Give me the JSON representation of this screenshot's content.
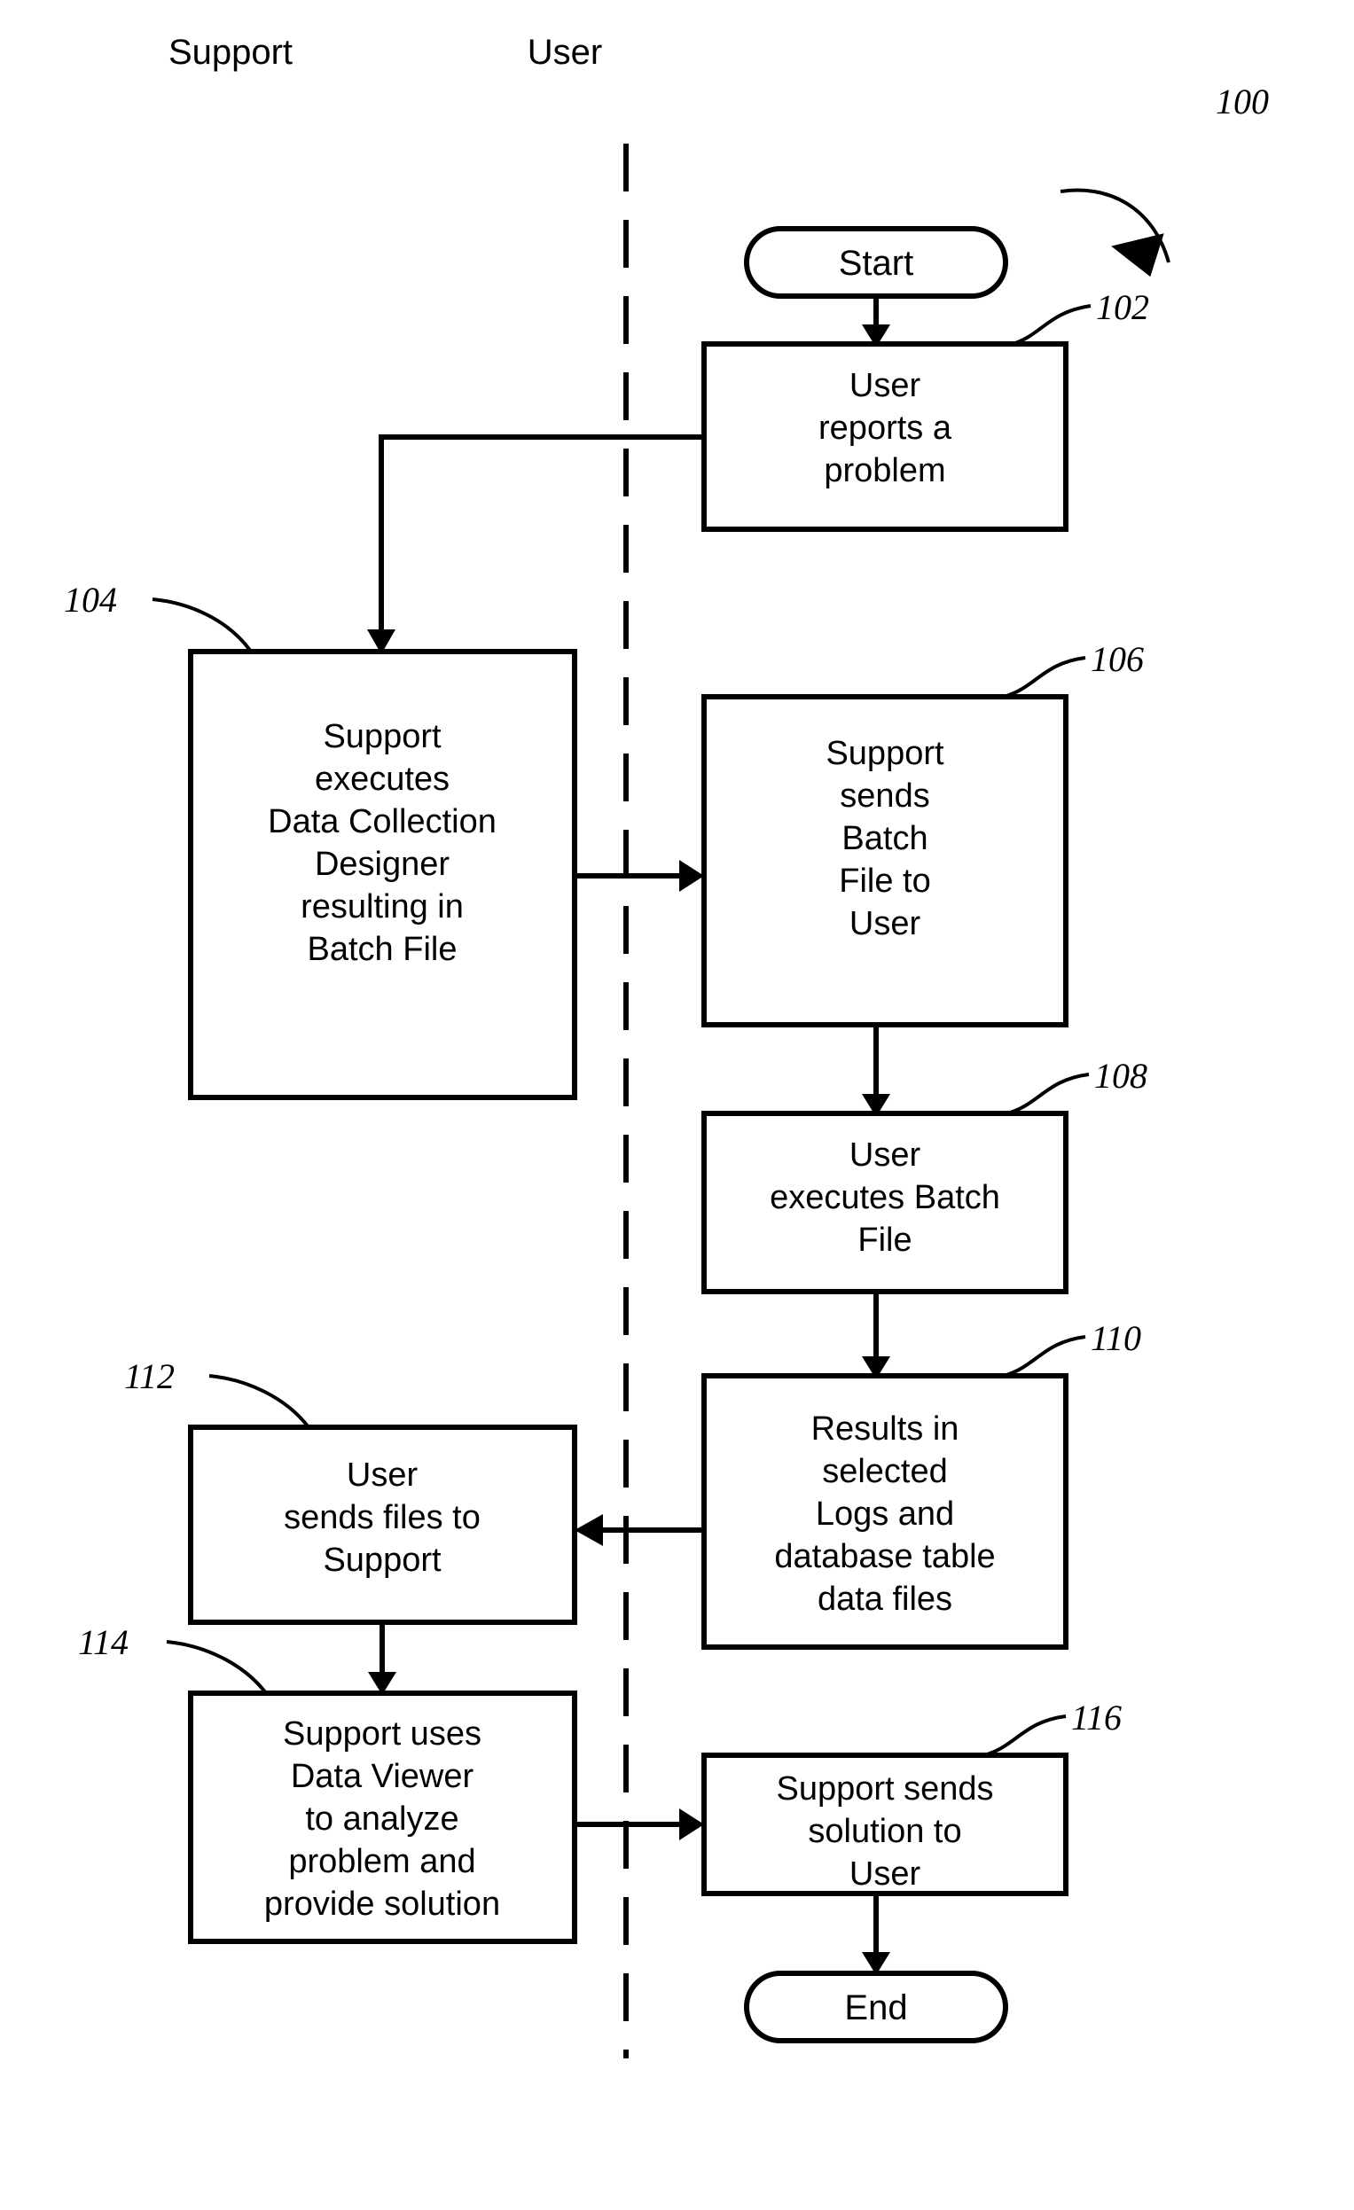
{
  "figure": {
    "reference_numeral": "100",
    "swimlanes": [
      {
        "id": "support",
        "label": "Support"
      },
      {
        "id": "user",
        "label": "User"
      }
    ],
    "terminators": {
      "start": "Start",
      "end": "End"
    },
    "nodes": [
      {
        "ref": "102",
        "lane": "user",
        "lines": [
          "User",
          "reports a",
          "problem"
        ]
      },
      {
        "ref": "104",
        "lane": "support",
        "lines": [
          "Support",
          "executes",
          "Data Collection",
          "Designer",
          "resulting in",
          "Batch File"
        ]
      },
      {
        "ref": "106",
        "lane": "user",
        "lines": [
          "Support",
          "sends",
          "Batch",
          "File to",
          "User"
        ]
      },
      {
        "ref": "108",
        "lane": "user",
        "lines": [
          "User",
          "executes Batch",
          "File"
        ]
      },
      {
        "ref": "110",
        "lane": "user",
        "lines": [
          "Results in",
          "selected",
          "Logs and",
          "database table",
          "data files"
        ]
      },
      {
        "ref": "112",
        "lane": "support",
        "lines": [
          "User",
          "sends files to",
          "Support"
        ]
      },
      {
        "ref": "114",
        "lane": "support",
        "lines": [
          "Support uses",
          "Data Viewer",
          "to analyze",
          "problem and",
          "provide solution"
        ]
      },
      {
        "ref": "116",
        "lane": "user",
        "lines": [
          "Support sends",
          "solution to",
          "User"
        ]
      }
    ],
    "node_text": {
      "n102_l1": "User",
      "n102_l2": "reports a",
      "n102_l3": "problem",
      "n104_l1": "Support",
      "n104_l2": "executes",
      "n104_l3": "Data Collection",
      "n104_l4": "Designer",
      "n104_l5": "resulting in",
      "n104_l6": "Batch File",
      "n106_l1": "Support",
      "n106_l2": "sends",
      "n106_l3": "Batch",
      "n106_l4": "File to",
      "n106_l5": "User",
      "n108_l1": "User",
      "n108_l2": "executes Batch",
      "n108_l3": "File",
      "n110_l1": "Results in",
      "n110_l2": "selected",
      "n110_l3": "Logs and",
      "n110_l4": "database table",
      "n110_l5": "data files",
      "n112_l1": "User",
      "n112_l2": "sends files to",
      "n112_l3": "Support",
      "n114_l1": "Support uses",
      "n114_l2": "Data Viewer",
      "n114_l3": "to analyze",
      "n114_l4": "problem and",
      "n114_l5": "provide solution",
      "n116_l1": "Support sends",
      "n116_l2": "solution to",
      "n116_l3": "User"
    },
    "ref_labels": {
      "fig": "100",
      "r102": "102",
      "r104": "104",
      "r106": "106",
      "r108": "108",
      "r110": "110",
      "r112": "112",
      "r114": "114",
      "r116": "116"
    },
    "colors": {
      "stroke": "#000000",
      "fill": "#ffffff",
      "background": "#ffffff"
    }
  }
}
